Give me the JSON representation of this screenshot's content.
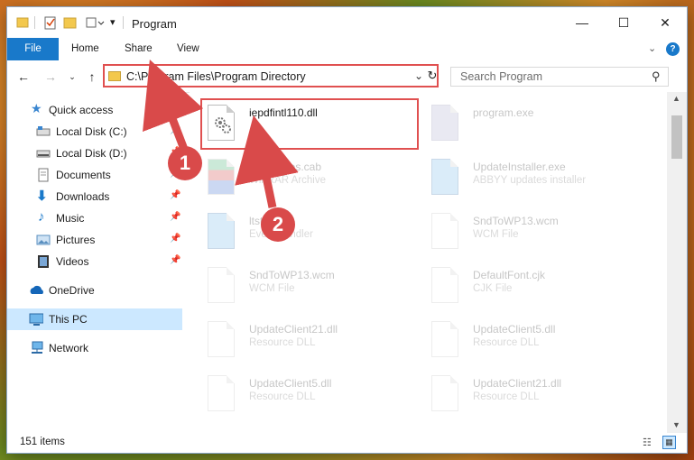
{
  "window": {
    "title": "Program",
    "controls": {
      "minimize": "—",
      "maximize": "☐",
      "close": "✕"
    }
  },
  "ribbon": {
    "tabs": [
      "File",
      "Home",
      "Share",
      "View"
    ]
  },
  "address": {
    "path": "C:\\Program Files\\Program Directory",
    "search_placeholder": "Search Program"
  },
  "sidebar": {
    "items": [
      {
        "label": "Quick access",
        "icon": "star-icon"
      },
      {
        "label": "Local Disk (C:)",
        "icon": "drive-icon"
      },
      {
        "label": "Local Disk (D:)",
        "icon": "drive-icon"
      },
      {
        "label": "Documents",
        "icon": "documents-icon"
      },
      {
        "label": "Downloads",
        "icon": "download-icon"
      },
      {
        "label": "Music",
        "icon": "music-icon"
      },
      {
        "label": "Pictures",
        "icon": "pictures-icon"
      },
      {
        "label": "Videos",
        "icon": "videos-icon"
      },
      {
        "label": "OneDrive",
        "icon": "cloud-icon"
      },
      {
        "label": "This PC",
        "icon": "computer-icon"
      },
      {
        "label": "Network",
        "icon": "network-icon"
      }
    ]
  },
  "files": [
    {
      "name": "iepdfintl110.dll",
      "type": ""
    },
    {
      "name": "program.exe",
      "type": ""
    },
    {
      "name": "certificates.cab",
      "type": "WinRAR Archive"
    },
    {
      "name": "UpdateInstaller.exe",
      "type": "ABBYY updates installer"
    },
    {
      "name": "ltst.exe",
      "type": "Event handler"
    },
    {
      "name": "SndToWP13.wcm",
      "type": "WCM File"
    },
    {
      "name": "SndToWP13.wcm",
      "type": "WCM File"
    },
    {
      "name": "DefaultFont.cjk",
      "type": "CJK File"
    },
    {
      "name": "UpdateClient21.dll",
      "type": "Resource DLL"
    },
    {
      "name": "UpdateClient5.dll",
      "type": "Resource DLL"
    },
    {
      "name": "UpdateClient5.dll",
      "type": "Resource DLL"
    },
    {
      "name": "UpdateClient21.dll",
      "type": "Resource DLL"
    }
  ],
  "status": {
    "item_count": "151 items"
  },
  "annotations": {
    "step1": "1",
    "step2": "2"
  },
  "colors": {
    "accent": "#1979ca",
    "highlight": "#e05050",
    "badge": "#d94a4a"
  }
}
